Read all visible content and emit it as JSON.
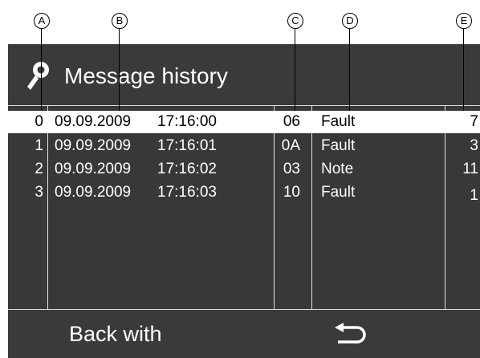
{
  "callouts": [
    "A",
    "B",
    "C",
    "D",
    "E"
  ],
  "header": {
    "title": "Message history",
    "icon": "key-icon"
  },
  "rows": [
    {
      "index": "0",
      "date": "09.09.2009",
      "time": "17:16:00",
      "code": "06",
      "type": "Fault",
      "count": "7",
      "selected": true
    },
    {
      "index": "1",
      "date": "09.09.2009",
      "time": "17:16:01",
      "code": "0A",
      "type": "Fault",
      "count": "3",
      "selected": false
    },
    {
      "index": "2",
      "date": "09.09.2009",
      "time": "17:16:02",
      "code": "03",
      "type": "Note",
      "count": "11",
      "selected": false
    },
    {
      "index": "3",
      "date": "09.09.2009",
      "time": "17:16:03",
      "code": "10",
      "type": "Fault",
      "count": "1",
      "selected": false
    }
  ],
  "footer": {
    "back_label": "Back with",
    "back_icon": "return-arrow-icon"
  }
}
